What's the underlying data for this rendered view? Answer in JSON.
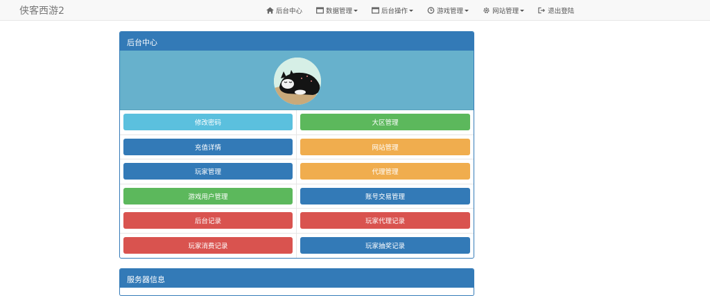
{
  "brand": "侠客西游2",
  "nav": [
    {
      "label": "后台中心",
      "icon": "home-icon",
      "dropdown": false
    },
    {
      "label": "数据管理",
      "icon": "window-icon",
      "dropdown": true
    },
    {
      "label": "后台操作",
      "icon": "window-icon",
      "dropdown": true
    },
    {
      "label": "游戏管理",
      "icon": "clock-icon",
      "dropdown": true
    },
    {
      "label": "网站管理",
      "icon": "gear-icon",
      "dropdown": true
    },
    {
      "label": "退出登陆",
      "icon": "logout-icon",
      "dropdown": false
    }
  ],
  "panel": {
    "title": "后台中心",
    "buttons": [
      [
        {
          "label": "修改密码",
          "color": "#5bc0de"
        },
        {
          "label": "大区管理",
          "color": "#5cb85c"
        }
      ],
      [
        {
          "label": "充值详情",
          "color": "#337ab7"
        },
        {
          "label": "网站管理",
          "color": "#f0ad4e"
        }
      ],
      [
        {
          "label": "玩家管理",
          "color": "#337ab7"
        },
        {
          "label": "代理管理",
          "color": "#f0ad4e"
        }
      ],
      [
        {
          "label": "游戏用户管理",
          "color": "#5cb85c"
        },
        {
          "label": "账号交易管理",
          "color": "#337ab7"
        }
      ],
      [
        {
          "label": "后台记录",
          "color": "#d9534f"
        },
        {
          "label": "玩家代理记录",
          "color": "#d9534f"
        }
      ],
      [
        {
          "label": "玩家消费记录",
          "color": "#d9534f"
        },
        {
          "label": "玩家抽奖记录",
          "color": "#337ab7"
        }
      ]
    ]
  },
  "panel2": {
    "title": "服务器信息"
  }
}
